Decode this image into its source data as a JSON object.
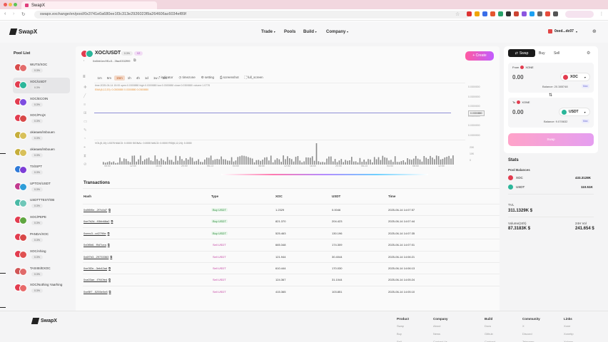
{
  "browser": {
    "tab_title": "SwapX",
    "url": "swapx.exchange/en/pool/0x3741e0a680ee1f3c313e2926023f9a264606ac6034ef89f"
  },
  "nav": {
    "logo": "SwapX",
    "items": [
      "Trade",
      "Pools",
      "Build",
      "Company"
    ],
    "wallet": "0xed...dc07"
  },
  "sidebar": {
    "title": "Pool List",
    "pools": [
      {
        "name": "WUTS/XOC",
        "badge": "0.3%",
        "c1": "#d84b4b",
        "c2": "#e36c6c"
      },
      {
        "name": "XOC/USDT",
        "badge": "0.3%",
        "c1": "#e23c4f",
        "c2": "#2bb69a",
        "selected": true
      },
      {
        "name": "XOC/ECOIN",
        "badge": "0.3%",
        "c1": "#e23c4f",
        "c2": "#7e4de0"
      },
      {
        "name": "XOC/ProjX",
        "badge": "0.3%",
        "c1": "#e23c4f",
        "c2": "#d84848"
      },
      {
        "name": "okieaws/imbouen",
        "badge": "0.3%",
        "c1": "#c6ae3b",
        "c2": "#d8c05a"
      },
      {
        "name": "okieaws/imbouen",
        "badge": "0.3%",
        "c1": "#c6ae3b",
        "c2": "#d8c05a"
      },
      {
        "name": "TX/ISPT",
        "badge": "0.3%",
        "c1": "#2f7ad8",
        "c2": "#7d3ed6"
      },
      {
        "name": "UPTOX/USDT",
        "badge": "0.3%",
        "c1": "#c13a8f",
        "c2": "#2f9dd8"
      },
      {
        "name": "USDTTTEST/OB",
        "badge": "0.3%",
        "c1": "#49b9a6",
        "c2": "#6fc7b8"
      },
      {
        "name": "XOC/PEPE",
        "badge": "0.3%",
        "c1": "#e23c4f",
        "c2": "#5fa640"
      },
      {
        "name": "PANDA/XOC",
        "badge": "0.3%",
        "c1": "#e23c4f",
        "c2": "#d84848"
      },
      {
        "name": "XOC/Ahing",
        "badge": "0.3%",
        "c1": "#e23c4f",
        "c2": "#e05252"
      },
      {
        "name": "TASIIIII/EXOC",
        "badge": "0.3%",
        "c1": "#d05656",
        "c2": "#e06a6a"
      },
      {
        "name": "XOC/Nothing Yaarhing",
        "badge": "0.3%",
        "c1": "#e23c4f",
        "c2": "#e86a6a"
      }
    ]
  },
  "pair": {
    "title": "XOC/USDT",
    "fee_badge": "0.3%",
    "chain_badge": "V2",
    "address": "0x6bb1ec9f1c3...3fac0332f99",
    "create_button": "+ Create"
  },
  "chart_toolbar": {
    "intervals": [
      "1m",
      "5m",
      "15m",
      "1h",
      "4h",
      "1d",
      "1w",
      "1M"
    ],
    "active_interval": "15m",
    "tools": [
      "indicator",
      "timezone",
      "setting",
      "screenshot",
      "full_screen"
    ]
  },
  "chart_info": {
    "line1": "time:2025-06-14 15:00   open:0.0300880   high:0.0300880   low:0.0300880   close:0.0300880   volume:1.0778",
    "line2": "EMA(6,12,20):   0.0300880   0.0300880   0.0300880",
    "sub_line": "VOL(5,10):1.5378   MACD: 0.0000   SIGNAL: 0.0000   MACD: 0.0000   RSI(6,12,24): 0.0000"
  },
  "chart_axis": {
    "y_right": [
      "0.0300000",
      "0.0300000",
      "0.0300000",
      "0.0300000",
      "0.0300000",
      "0.0300000"
    ],
    "price_tag": "0.0300880",
    "vol_right": [
      "20K",
      "10K",
      "0"
    ],
    "x_labels": [
      "08:00",
      "12:00",
      "16:00",
      "20:00",
      "06-13",
      "04:00",
      "08:00",
      "12:00",
      "16:00",
      "20:00",
      "06-14",
      "04:00",
      "08:00",
      "12:00"
    ]
  },
  "transactions": {
    "title": "Transactions",
    "columns": [
      "Hash",
      "Type",
      "XOC",
      "USDT",
      "Time"
    ],
    "rows": [
      {
        "hash": "0x8f6f0e...2f7d4d7",
        "type": "Buy USDT",
        "xoc": "1.2329",
        "usdt": "0.0046",
        "time": "2025-06-14 14:07:57"
      },
      {
        "hash": "0xe7b2d...93bb68a2",
        "type": "Buy USDT",
        "xoc": "821.370",
        "usdt": "204.423",
        "time": "2025-06-14 14:07:44"
      },
      {
        "hash": "0xeec3...cd2799e",
        "type": "Buy USDT",
        "xoc": "525.463",
        "usdt": "130.196",
        "time": "2025-06-14 14:07:35"
      },
      {
        "hash": "0x0f8b6...f9d7cea",
        "type": "Sell USDT",
        "xoc": "665.348",
        "usdt": "174.309",
        "time": "2025-06-14 14:07:01"
      },
      {
        "hash": "0x6f7b3...29733363",
        "type": "Sell USDT",
        "xoc": "121.944",
        "usdt": "30.4044",
        "time": "2025-06-14 14:06:21"
      },
      {
        "hash": "0xe3f2e...3eb42ad",
        "type": "Sell USDT",
        "xoc": "610.444",
        "usdt": "170.030",
        "time": "2025-06-14 14:06:13"
      },
      {
        "hash": "0xa03ae...f7f40fed",
        "type": "Sell USDT",
        "xoc": "124.367",
        "usdt": "31.1044",
        "time": "2025-06-14 14:05:24"
      },
      {
        "hash": "0xeBf7...5255e0e8",
        "type": "Sell USDT",
        "xoc": "415.365",
        "usdt": "103.851",
        "time": "2025-06-14 14:05:10"
      }
    ]
  },
  "swap": {
    "tabs": [
      "Swap",
      "Buy",
      "Sell"
    ],
    "from_label": "From",
    "from_token_hint": "XONE",
    "from_amount": "0.00",
    "from_token": "XOC",
    "from_balance": "Balance: 20.385748",
    "max": "Max",
    "to_label": "To",
    "to_token_hint": "XONE",
    "to_amount": "0.00",
    "to_token": "USDT",
    "to_balance": "Balance: 9.078632",
    "submit": "Swap"
  },
  "stats": {
    "title": "Stats",
    "pool_balances_label": "Pool Balances",
    "balance_xoc_token": "XOC",
    "balance_xoc": "433.3128K",
    "balance_usdt_token": "USDT",
    "balance_usdt": "110.51K",
    "tvl_label": "TVL",
    "tvl": "311.1329K $",
    "volume_label": "Volume(24h)",
    "volume": "87.3183K $",
    "vol24_label": "24H Vol",
    "vol24": "241.654 $"
  },
  "footer": {
    "logo": "SwapX",
    "columns": [
      {
        "title": "Product",
        "links": [
          "Swap",
          "Buy",
          "Sell"
        ]
      },
      {
        "title": "Company",
        "links": [
          "About",
          "News",
          "Contact Us"
        ]
      },
      {
        "title": "Build",
        "links": [
          "Docs",
          "Github",
          "Contract"
        ]
      },
      {
        "title": "Community",
        "links": [
          "X",
          "Discord",
          "Telegram"
        ]
      },
      {
        "title": "Links",
        "links": [
          "Xone",
          "Xonetip",
          "Xplorer"
        ]
      }
    ]
  }
}
